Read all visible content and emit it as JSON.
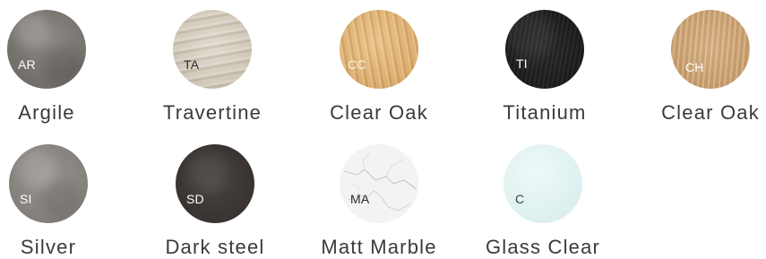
{
  "swatches": [
    {
      "code": "AR",
      "name": "Argile"
    },
    {
      "code": "TA",
      "name": "Travertine"
    },
    {
      "code": "CC",
      "name": "Clear Oak"
    },
    {
      "code": "TI",
      "name": "Titanium"
    },
    {
      "code": "CH",
      "name": "Clear Oak"
    },
    {
      "code": "SI",
      "name": "Silver"
    },
    {
      "code": "SD",
      "name": "Dark steel"
    },
    {
      "code": "MA",
      "name": "Matt Marble"
    },
    {
      "code": "C",
      "name": "Glass Clear"
    }
  ]
}
